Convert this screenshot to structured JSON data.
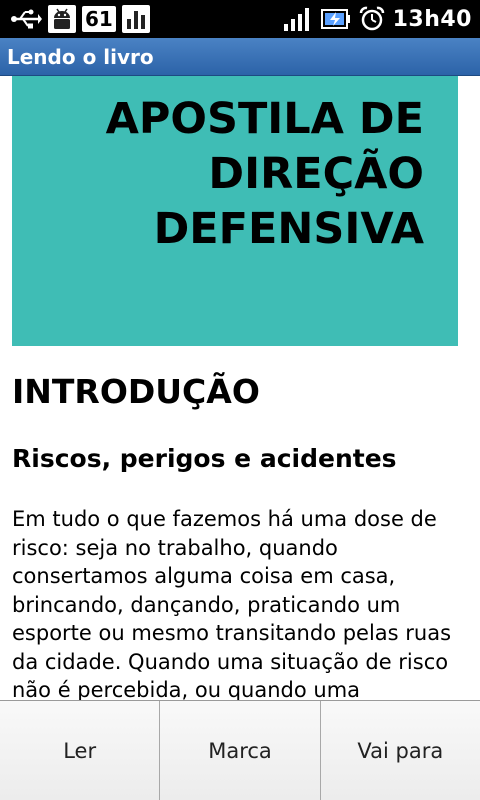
{
  "status_bar": {
    "icons": [
      "usb-icon",
      "android-debug-icon",
      "notification-count-badge",
      "bar-chart-icon",
      "signal-icon",
      "battery-icon",
      "alarm-clock-icon"
    ],
    "notification_count": "61",
    "time": "13h40"
  },
  "title_bar": {
    "title": "Lendo o livro"
  },
  "book": {
    "cover_title": "APOSTILA DE DIREÇÃO DEFENSIVA",
    "cover_color": "#3fbdb5",
    "heading": "INTRODUÇÃO",
    "subheading": "Riscos, perigos e acidentes",
    "paragraph": "Em tudo o que fazemos há uma dose de risco: seja no trabalho, quando consertamos alguma coisa em casa, brincando, dançando, praticando um esporte ou mesmo transitando pelas ruas da cidade. Quando uma situação de risco não é percebida, ou quando uma"
  },
  "menu": {
    "items": [
      {
        "label": "Ler"
      },
      {
        "label": "Marca"
      },
      {
        "label": "Vai para"
      }
    ]
  },
  "colors": {
    "title_bar": "#2c63a8",
    "status_bar": "#000000"
  }
}
